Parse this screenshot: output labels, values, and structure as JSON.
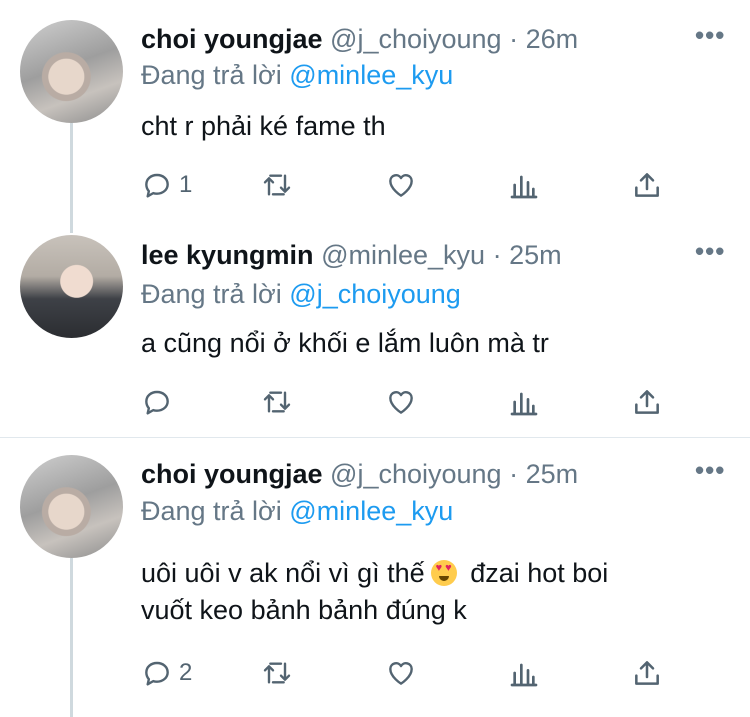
{
  "tweets": [
    {
      "name": "choi youngjae",
      "handle": "@j_choiyoung",
      "sep": "·",
      "time": "26m",
      "reply_prefix": "Đang trả lời",
      "reply_mention": "@minlee_kyu",
      "text": "cht r phải ké fame th",
      "reply_count": "1",
      "more": "•••"
    },
    {
      "name": "lee kyungmin",
      "handle": "@minlee_kyu",
      "sep": "·",
      "time": "25m",
      "reply_prefix": "Đang trả lời",
      "reply_mention": "@j_choiyoung",
      "text": "a cũng nổi ở khối e lắm luôn mà tr",
      "reply_count": "",
      "more": "•••"
    },
    {
      "name": "choi youngjae",
      "handle": "@j_choiyoung",
      "sep": "·",
      "time": "25m",
      "reply_prefix": "Đang trả lời",
      "reply_mention": "@minlee_kyu",
      "text_line1_a": "uôi uôi v ak nổi vì gì thế",
      "text_line1_b": "đzai hot boi",
      "text_line2": "vuốt keo bảnh bảnh đúng k",
      "reply_count": "2",
      "more": "•••"
    }
  ],
  "icons": [
    "reply-icon",
    "retweet-icon",
    "like-icon",
    "analytics-icon",
    "share-icon",
    "smiling-face-with-heart-eyes-emoji"
  ],
  "colors": {
    "mention": "#1d9bf0",
    "meta": "#657786",
    "icon": "#536471",
    "thread_line": "#cfd9de"
  }
}
